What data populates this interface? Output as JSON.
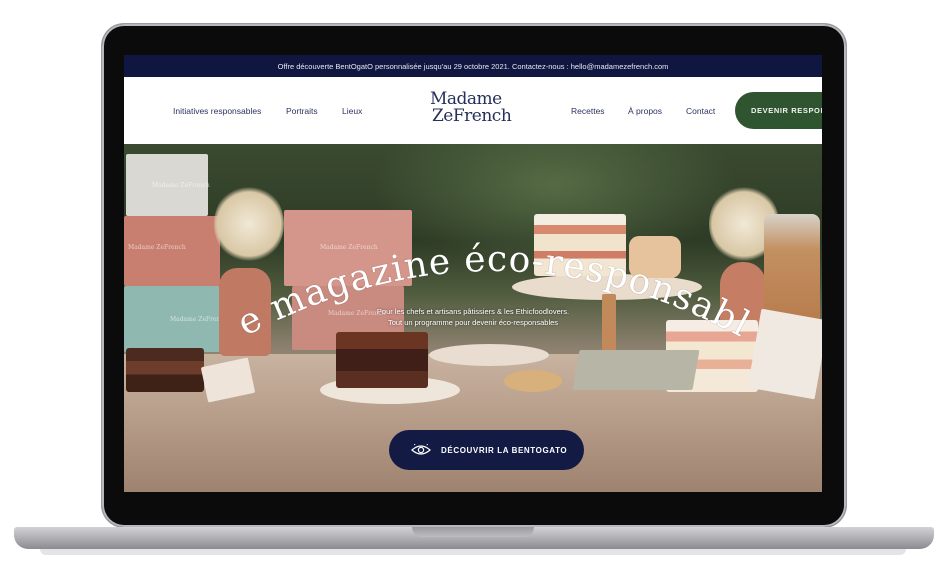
{
  "announcement": "Offre découverte BentOgatO personnalisée jusqu'au 29 octobre 2021. Contactez-nous : hello@madamezefrench.com",
  "nav": {
    "left_links": [
      "Initiatives responsables",
      "Portraits",
      "Lieux"
    ],
    "right_links": [
      "Recettes",
      "À propos",
      "Contact"
    ],
    "cta_label": "DEVENIR RESPON"
  },
  "logo": {
    "line1": "Madame",
    "line2": "ZeFrench"
  },
  "hero": {
    "headline": "Le magazine éco-responsable",
    "subtitle_line1": "Pour les chefs et artisans pâtissiers & les Ethicfoodlovers.",
    "subtitle_line2": "Tout un programme pour devenir éco-responsables",
    "button_label": "DÉCOUVRIR LA BENTOGATO",
    "button_icon": "eye-icon"
  },
  "box_print": "Madame ZeFrench",
  "colors": {
    "announcement_bg": "#0f1640",
    "nav_text": "#2c3360",
    "cta_bg": "#2f5530",
    "hero_button_bg": "#131b45"
  }
}
